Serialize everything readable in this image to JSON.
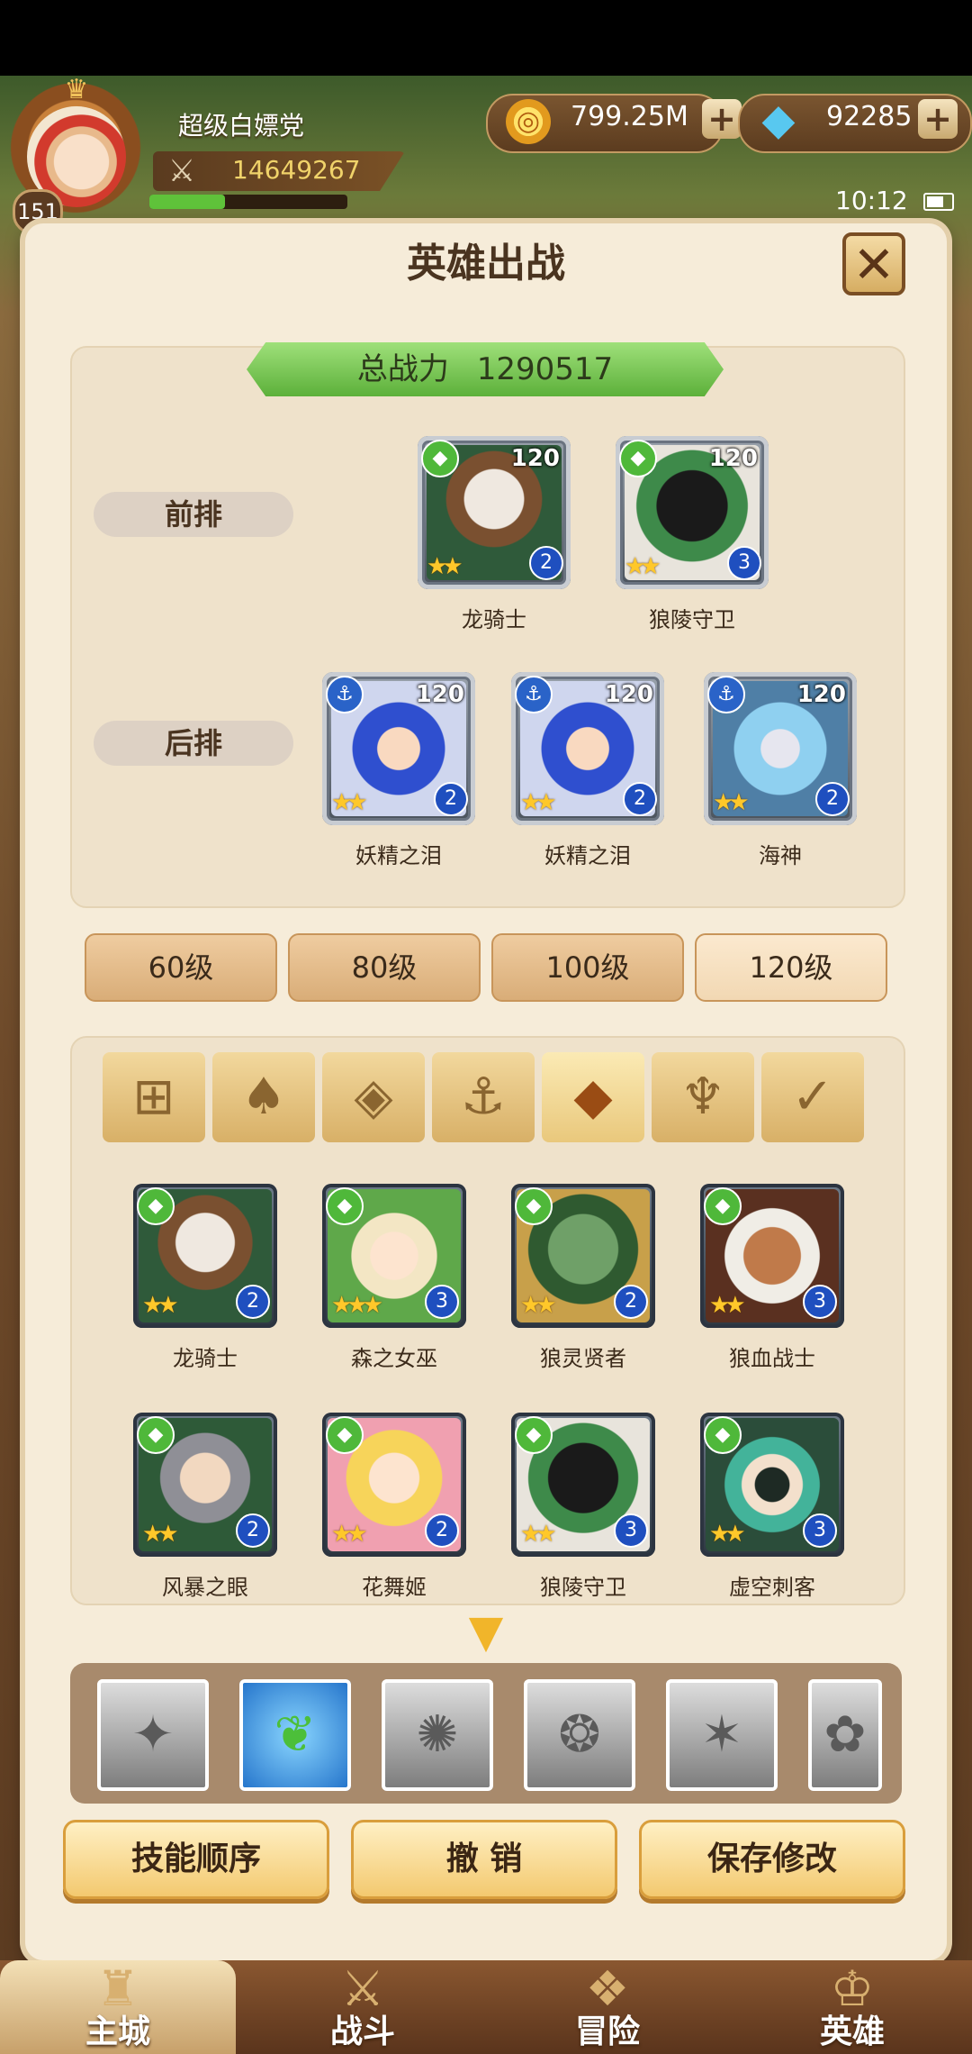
{
  "player": {
    "name": "超级白嫖党",
    "power": "14649267",
    "level": "151",
    "exp_fraction": 0.38
  },
  "currency": {
    "gold": "799.25M",
    "gems": "92285",
    "plus": "+"
  },
  "status": {
    "time": "10:12"
  },
  "panel": {
    "title": "英雄出战",
    "close": "✕",
    "total_power_label": "总战力",
    "total_power_value": "1290517",
    "front_label": "前排",
    "back_label": "后排"
  },
  "formation": {
    "front": [
      {
        "name": "龙骑士",
        "level": "120",
        "stars": "★★",
        "rank": "2",
        "faction": "beast",
        "art": "dragon"
      },
      {
        "name": "狼陵守卫",
        "level": "120",
        "stars": "★★",
        "rank": "3",
        "faction": "beast",
        "art": "wolfguard"
      }
    ],
    "back": [
      {
        "name": "妖精之泪",
        "level": "120",
        "stars": "★★",
        "rank": "2",
        "faction": "sea",
        "art": "fairy"
      },
      {
        "name": "妖精之泪",
        "level": "120",
        "stars": "★★",
        "rank": "2",
        "faction": "sea",
        "art": "fairy"
      },
      {
        "name": "海神",
        "level": "120",
        "stars": "★★",
        "rank": "2",
        "faction": "sea",
        "art": "sea"
      }
    ]
  },
  "level_tabs": [
    "60级",
    "80级",
    "100级",
    "120级"
  ],
  "filter_tabs": [
    {
      "icon": "grid-icon",
      "glyph": "⊞"
    },
    {
      "icon": "forest-icon",
      "glyph": "♠"
    },
    {
      "icon": "diamond-icon",
      "glyph": "◈"
    },
    {
      "icon": "anchor-icon",
      "glyph": "⚓"
    },
    {
      "icon": "beast-icon",
      "glyph": "◆",
      "selected": true
    },
    {
      "icon": "horns-icon",
      "glyph": "♆"
    },
    {
      "icon": "wings-icon",
      "glyph": "✓"
    }
  ],
  "hero_list": [
    {
      "name": "龙骑士",
      "stars": "★★",
      "rank": "2",
      "art": "dragon"
    },
    {
      "name": "森之女巫",
      "stars": "★★★",
      "rank": "3",
      "art": "witch"
    },
    {
      "name": "狼灵贤者",
      "stars": "★★",
      "rank": "2",
      "art": "sage"
    },
    {
      "name": "狼血战士",
      "stars": "★★",
      "rank": "3",
      "art": "blood"
    },
    {
      "name": "风暴之眼",
      "stars": "★★",
      "rank": "2",
      "art": "storm"
    },
    {
      "name": "花舞姬",
      "stars": "★★",
      "rank": "2",
      "art": "flower"
    },
    {
      "name": "狼陵守卫",
      "stars": "★★",
      "rank": "3",
      "art": "wolfguard"
    },
    {
      "name": "虚空刺客",
      "stars": "★★",
      "rank": "3",
      "art": "void"
    }
  ],
  "skills": [
    "✦",
    "❦",
    "✺",
    "❂",
    "✶",
    "✿"
  ],
  "actions": {
    "skill_order": "技能顺序",
    "cancel": "撤 销",
    "save": "保存修改"
  },
  "nav": {
    "city": "主城",
    "battle": "战斗",
    "adventure": "冒险",
    "hero": "英雄"
  },
  "colors": {
    "gold_accent": "#f1b52a",
    "panel_bg": "#f6ecd9",
    "beast_faction": "#4fb83a",
    "sea_faction": "#2a63c8"
  }
}
